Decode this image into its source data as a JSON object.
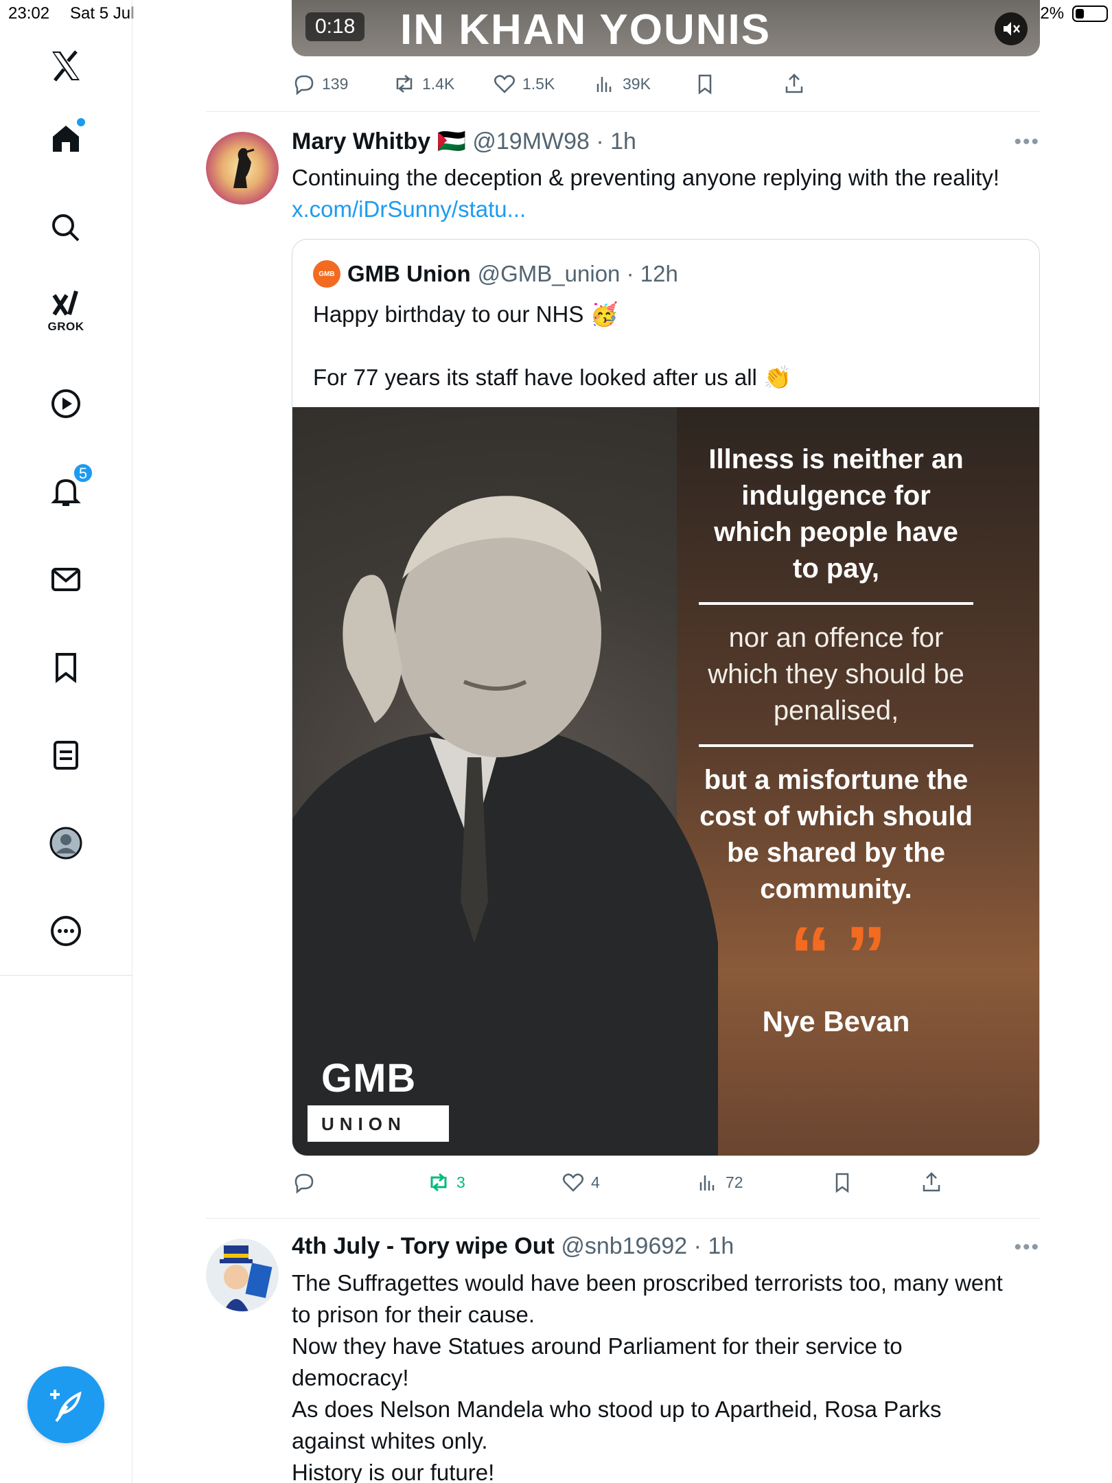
{
  "status_bar": {
    "time": "23:02",
    "date": "Sat 5 Jul",
    "battery": "32%"
  },
  "sidebar": {
    "grok_label": "GROK",
    "notifications_count": "5"
  },
  "previous_tweet": {
    "video_duration": "0:18",
    "video_caption": "IN KHAN YOUNIS",
    "stats": {
      "replies": "139",
      "reposts": "1.4K",
      "likes": "1.5K",
      "views": "39K"
    }
  },
  "tweet1": {
    "name": "Mary Whitby 🇵🇸",
    "handle_time": "@19MW98 · 1h",
    "text": "Continuing the deception & preventing anyone replying with the reality!",
    "link": "x.com/iDrSunny/statu...",
    "quote": {
      "logo_text": "GMB",
      "name": "GMB Union",
      "handle_time": "@GMB_union · 12h",
      "text_line1": "Happy birthday to our NHS 🥳",
      "text_line2": "For 77 years its staff have looked after us all 👏",
      "image": {
        "part1": "Illness is neither an indulgence for which people have to pay,",
        "part2": "nor an offence for which they should be penalised,",
        "part3": "but a misfortune the cost of which should be shared by the community.",
        "quote_marks": "“ ”",
        "author": "Nye Bevan",
        "logo_gmb": "GMB",
        "logo_union": "UNION"
      }
    },
    "stats": {
      "replies": "",
      "reposts": "3",
      "likes": "4",
      "views": "72"
    }
  },
  "tweet2": {
    "name": "4th July - Tory wipe Out",
    "handle_time": "@snb19692 · 1h",
    "lines": [
      "The Suffragettes would have been proscribed terrorists too, many went",
      "to prison for their cause.",
      "Now they have Statues around Parliament for their service to",
      "democracy!",
      "As does Nelson Mandela who stood up to Apartheid, Rosa Parks",
      "against whites only.",
      "History is our future!"
    ]
  },
  "colors": {
    "accent": "#1d9bf0",
    "repost_active": "#00ba7c",
    "gmb_orange": "#f26b21"
  }
}
